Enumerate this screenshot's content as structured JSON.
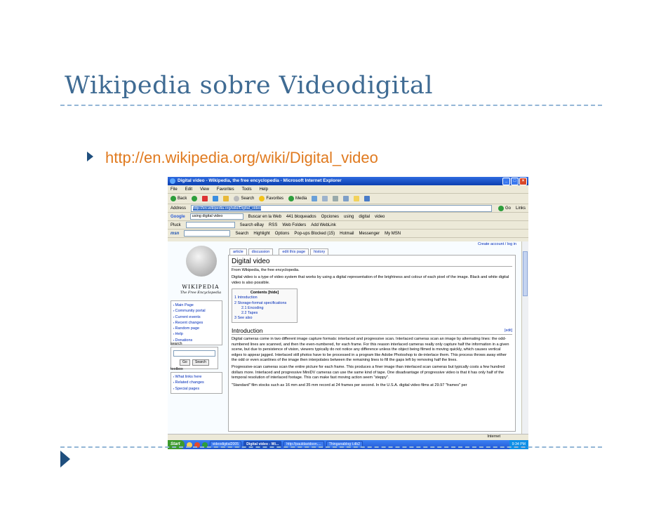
{
  "slide": {
    "title": "Wikipedia sobre Videodigital",
    "bullet_text": "http://en.wikipedia.org/wiki/Digital_video"
  },
  "browser": {
    "window_title": "Digital video - Wikipedia, the free encyclopedia - Microsoft Internet Explorer",
    "menu": [
      "File",
      "Edit",
      "View",
      "Favorites",
      "Tools",
      "Help"
    ],
    "toolbar": {
      "back": "Back",
      "search": "Search",
      "favorites": "Favorites",
      "media": "Media"
    },
    "address_label": "Address",
    "address_value": "http://en.wikipedia.org/wiki/Digital_video",
    "go_label": "Go",
    "links_label": "Links",
    "google_bar": {
      "brand": "Google",
      "query": "using digital video",
      "search_web": "Buscar en la Web",
      "blocked": "441 bloqueados",
      "options": "Opciones",
      "chip1": "using",
      "chip2": "digital",
      "chip3": "video"
    },
    "pluck_bar": {
      "brand": "Pluck",
      "search_ebay": "Search eBay",
      "rss": "RSS",
      "web_folders": "Web Folders",
      "add_weblink": "Add WebLink"
    },
    "msn_bar": {
      "brand": "msn",
      "search": "Search",
      "highlight": "Highlight",
      "options": "Options",
      "popups": "Pop-ups Blocked (15)",
      "hotmail": "Hotmail",
      "messenger": "Messenger",
      "my_msn": "My MSN"
    },
    "status_text": "Internet"
  },
  "wiki": {
    "create_account": "Create account / log in",
    "tabs": [
      "article",
      "discussion",
      "edit this page",
      "history"
    ],
    "logo_word": "WIKIPEDIA",
    "logo_sub": "The Free Encyclopedia",
    "nav": [
      "Main Page",
      "Community portal",
      "Current events",
      "Recent changes",
      "Random page",
      "Help",
      "Donations"
    ],
    "search_label": "search",
    "go_btn": "Go",
    "search_btn": "Search",
    "toolbox_label": "toolbox",
    "toolbox": [
      "What links here",
      "Related changes",
      "Special pages"
    ],
    "heading": "Digital video",
    "from": "From Wikipedia, the free encyclopedia.",
    "intro": "Digital video is a type of video system that works by using a digital representation of the brightness and colour of each pixel of the image. Black and white digital video is also possible.",
    "toc_title": "Contents [hide]",
    "toc": [
      "1 Introduction",
      "2 Storage-format specifications",
      "2.1 Encoding",
      "2.2 Tapes",
      "3 See also"
    ],
    "intro_heading": "Introduction",
    "edit_link": "[edit]",
    "para1": "Digital cameras come in two different image capture formats: interlaced and progressive scan. Interlaced cameras scan an image by alternating lines: the odd-numbered lines are scanned, and then the even-numbered, for each frame. For this reason interlaced cameras really only capture half the information in a given scene, but due to persistence of vision, viewers typically do not notice any difference unless the object being filmed is moving quickly, which causes vertical edges to appear jagged. Interlaced still photos have to be processed in a program like Adobe Photoshop to de-interlace them. This process throws away either the odd or even scanlines of the image then interpolates between the remaining lines to fill the gaps left by removing half the lines.",
    "para2": "Progressive-scan cameras scan the entire picture for each frame. This produces a finer image than interlaced scan cameras but typically costs a few hundred dollars more. Interlaced and progressive MiniDV cameras can use the same kind of tape. One disadvantage of progressive video is that it has only half of the temporal resolution of interlaced footage. This can make fast moving action seem \"steppy\".",
    "para3": "\"Standard\" film stocks such as 16 mm and 35 mm record at 24 frames per second. In the U.S.A. digital video films at 29.97 \"frames\" per"
  },
  "taskbar": {
    "start": "Start",
    "tasks": [
      "videodigital2005",
      "Digital video - Wi...",
      "http://pauldavidson....",
      "Thinganablog t.db2"
    ],
    "clock": "9:34 PM"
  }
}
